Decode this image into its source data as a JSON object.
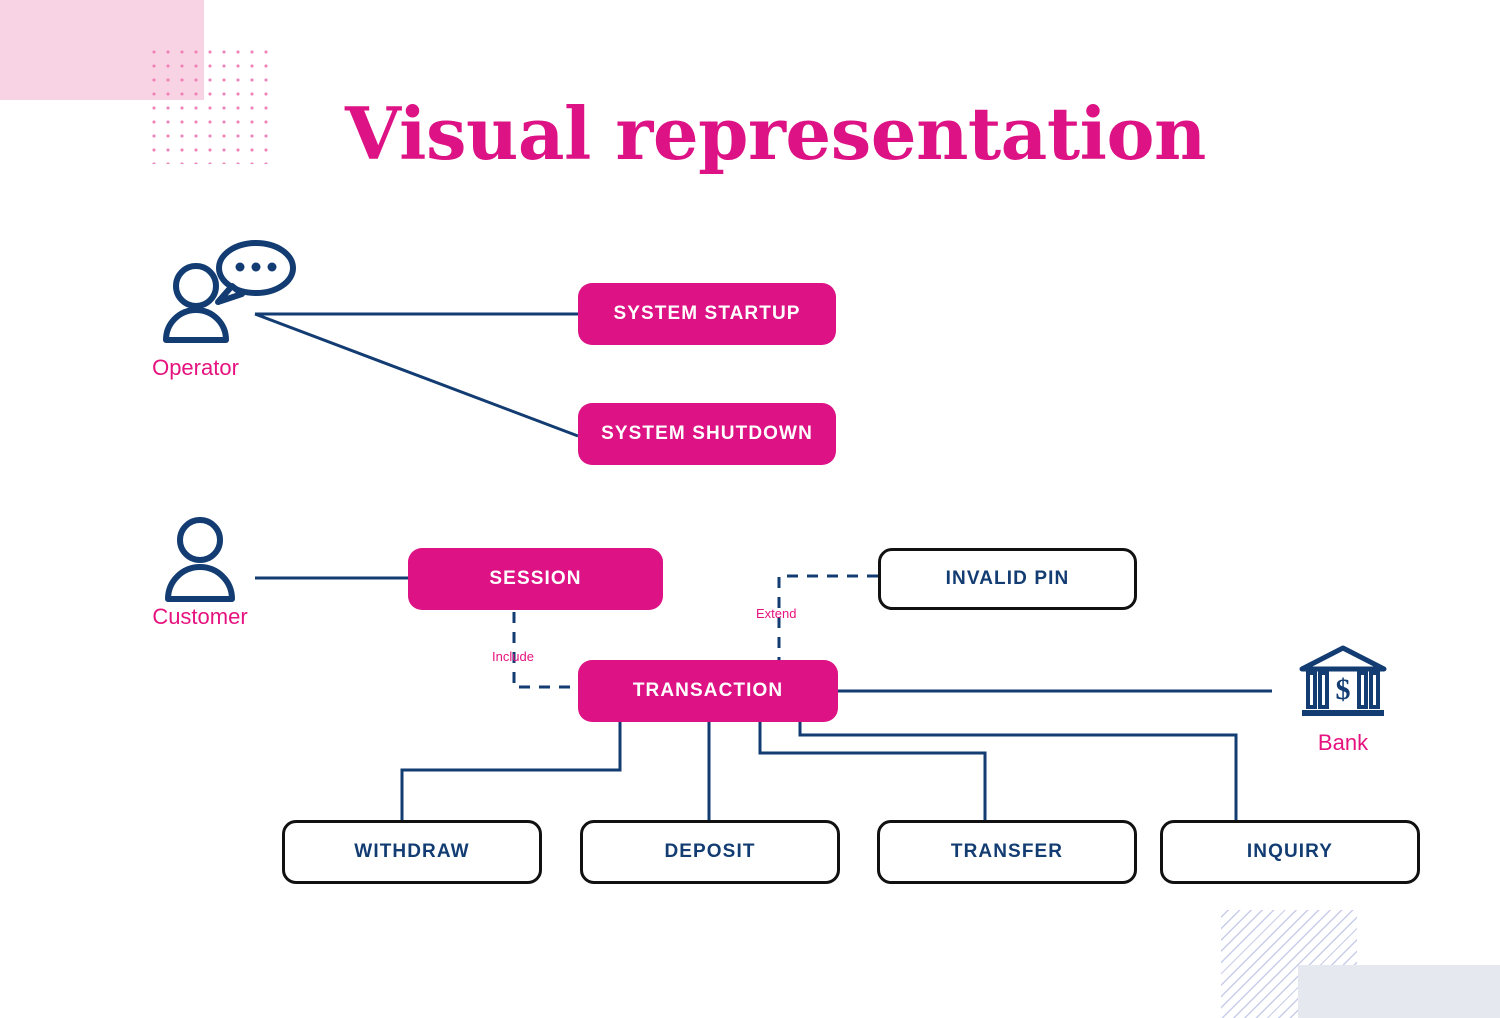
{
  "slide": {
    "title": "Visual representation",
    "background": "#FFFFFF"
  },
  "colors": {
    "accent_pink": "#DD1284",
    "label_pink": "#E6127F",
    "pale_pink": "#F8D3E4",
    "navy": "#123C72",
    "outline_black": "#111111",
    "stripe_blue": "#C9CDEA",
    "gray_blue": "#E5E9EF"
  },
  "actors": [
    {
      "id": "operator",
      "label": "Operator",
      "icon": "user-with-speech-bubble-icon"
    },
    {
      "id": "customer",
      "label": "Customer",
      "icon": "user-icon"
    },
    {
      "id": "bank",
      "label": "Bank",
      "icon": "bank-building-icon"
    }
  ],
  "use_cases": [
    {
      "id": "system-startup",
      "label": "SYSTEM STARTUP",
      "style": "filled"
    },
    {
      "id": "system-shutdown",
      "label": "SYSTEM SHUTDOWN",
      "style": "filled"
    },
    {
      "id": "session",
      "label": "SESSION",
      "style": "filled"
    },
    {
      "id": "invalid-pin",
      "label": "INVALID PIN",
      "style": "outlined"
    },
    {
      "id": "transaction",
      "label": "TRANSACTION",
      "style": "filled"
    },
    {
      "id": "withdraw",
      "label": "WITHDRAW",
      "style": "outlined"
    },
    {
      "id": "deposit",
      "label": "DEPOSIT",
      "style": "outlined"
    },
    {
      "id": "transfer",
      "label": "TRANSFER",
      "style": "outlined"
    },
    {
      "id": "inquiry",
      "label": "INQUIRY",
      "style": "outlined"
    }
  ],
  "relationships": [
    {
      "id": "include",
      "label": "Include",
      "from": "session",
      "to": "transaction",
      "line": "dashed"
    },
    {
      "id": "extend",
      "label": "Extend",
      "from": "invalid-pin",
      "to": "transaction",
      "line": "dashed"
    }
  ],
  "associations": [
    {
      "from": "operator",
      "to": "system-startup",
      "line": "solid"
    },
    {
      "from": "operator",
      "to": "system-shutdown",
      "line": "solid"
    },
    {
      "from": "customer",
      "to": "session",
      "line": "solid"
    },
    {
      "from": "bank",
      "to": "transaction",
      "line": "solid"
    },
    {
      "from": "transaction",
      "to": "withdraw",
      "line": "solid"
    },
    {
      "from": "transaction",
      "to": "deposit",
      "line": "solid"
    },
    {
      "from": "transaction",
      "to": "transfer",
      "line": "solid"
    },
    {
      "from": "transaction",
      "to": "inquiry",
      "line": "solid"
    }
  ]
}
